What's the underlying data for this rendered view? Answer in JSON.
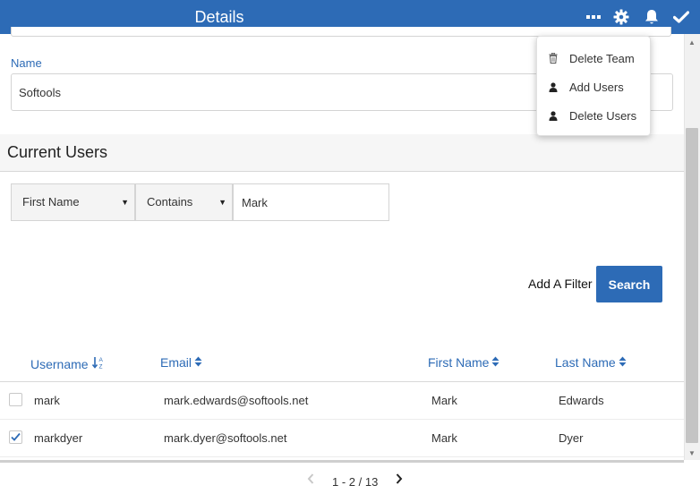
{
  "header": {
    "title": "Details",
    "icons": [
      "more-icon",
      "gear-icon",
      "bell-icon",
      "check-icon"
    ],
    "background": "#2d6bb6"
  },
  "form": {
    "name_label": "Name",
    "name_value": "Softools"
  },
  "section": {
    "title": "Current Users"
  },
  "filter": {
    "field": "First Name",
    "operator": "Contains",
    "value": "Mark",
    "add_filter_label": "Add A Filter",
    "search_label": "Search"
  },
  "table": {
    "columns": [
      "Username",
      "Email",
      "First Name",
      "Last Name"
    ],
    "rows": [
      {
        "checked": false,
        "username": "mark",
        "email": "mark.edwards@softools.net",
        "first_name": "Mark",
        "last_name": "Edwards"
      },
      {
        "checked": true,
        "username": "markdyer",
        "email": "mark.dyer@softools.net",
        "first_name": "Mark",
        "last_name": "Dyer"
      }
    ]
  },
  "pagination": {
    "text": "1 - 2 / 13"
  },
  "menu": {
    "items": [
      {
        "label": "Delete Team",
        "icon": "trash-icon"
      },
      {
        "label": "Add Users",
        "icon": "user-icon"
      },
      {
        "label": "Delete Users",
        "icon": "user-icon"
      }
    ]
  },
  "colors": {
    "accent": "#2d6bb6"
  }
}
